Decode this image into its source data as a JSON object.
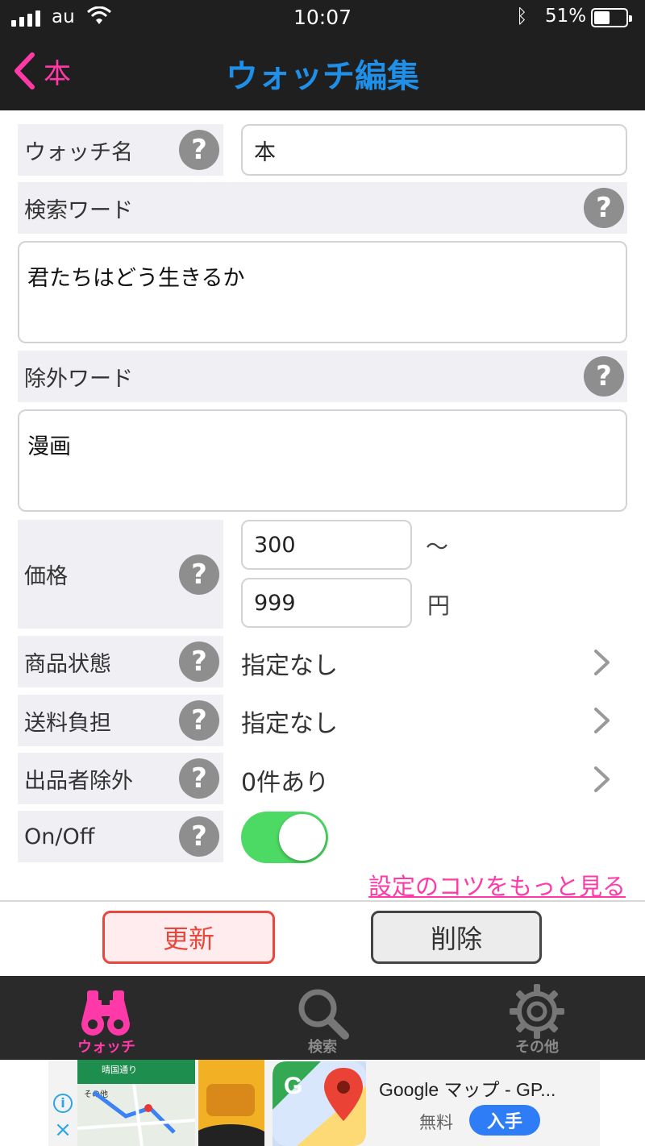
{
  "status_bar": {
    "carrier": "au",
    "time": "10:07",
    "battery": "51%",
    "battery_level": 0.51
  },
  "nav": {
    "back_label": "本",
    "title": "ウォッチ編集"
  },
  "form": {
    "watch_name": {
      "label": "ウォッチ名",
      "value": "本"
    },
    "search_words": {
      "label": "検索ワード",
      "value": "君たちはどう生きるか"
    },
    "exclude_words": {
      "label": "除外ワード",
      "value": "漫画"
    },
    "price": {
      "label": "価格",
      "min": "300",
      "max": "999",
      "range_symbol": "～",
      "unit": "円"
    },
    "condition": {
      "label": "商品状態",
      "value": "指定なし"
    },
    "shipping": {
      "label": "送料負担",
      "value": "指定なし"
    },
    "seller_exclude": {
      "label": "出品者除外",
      "value": "0件あり"
    },
    "onoff": {
      "label": "On/Off",
      "enabled": true
    }
  },
  "tips_link": "設定のコツをもっと見る",
  "actions": {
    "update": "更新",
    "delete": "削除"
  },
  "tabs": [
    {
      "label": "ウォッチ",
      "icon": "binoculars-icon",
      "active": true
    },
    {
      "label": "検索",
      "icon": "search-icon",
      "active": false
    },
    {
      "label": "その他",
      "icon": "gear-icon",
      "active": false
    }
  ],
  "colors": {
    "accent_pink": "#ff3aa8",
    "title_blue": "#1f8fe8",
    "toggle_green": "#4cd964",
    "update_red": "#e8473b"
  },
  "ad": {
    "app_name": "Google マップ - GP...",
    "price": "無料",
    "cta": "入手",
    "map_street": "晴国通り",
    "map_sub": "その他"
  }
}
